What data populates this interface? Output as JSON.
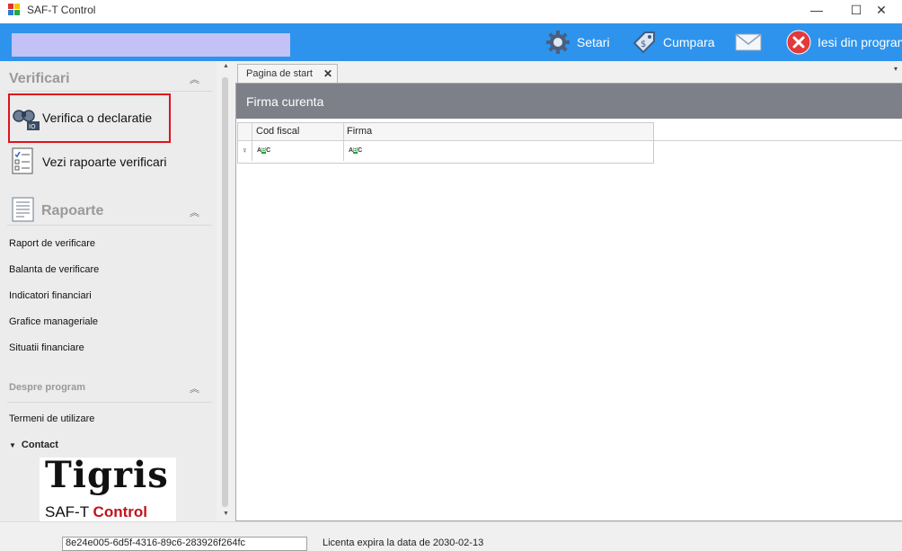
{
  "window": {
    "title": "SAF-T Control",
    "minimize": "—",
    "maximize": "☐",
    "close": "✕"
  },
  "toolbar": {
    "search_value": "",
    "setari_label": "Setari",
    "cumpara_label": "Cumpara",
    "exit_label": "Iesi din program",
    "bg_color": "#2e93ec"
  },
  "sidebar": {
    "verificari": {
      "title": "Verificari",
      "items": [
        {
          "label": "Verifica o declaratie",
          "icon": "binoculars-icon",
          "highlighted": true
        },
        {
          "label": "Vezi rapoarte verificari",
          "icon": "checklist-icon"
        }
      ]
    },
    "rapoarte": {
      "title": "Rapoarte",
      "items": [
        "Raport de verificare",
        "Balanta de verificare",
        "Indicatori financiari",
        "Grafice manageriale",
        "Situatii financiare"
      ]
    },
    "despre": {
      "title": "Despre program",
      "items": [
        "Termeni de utilizare"
      ],
      "contact_label": "Contact"
    },
    "logo": {
      "brand": "Tigris",
      "product_prefix": "SAF-T",
      "product_suffix": "Control"
    }
  },
  "main": {
    "tab_label": "Pagina de start",
    "panel_title": "Firma curenta",
    "grid": {
      "columns": [
        "Cod fiscal",
        "Firma"
      ]
    }
  },
  "status": {
    "license_key": "8e24e005-6d5f-4316-89c6-283926f264fc",
    "license_text": "Licenta expira la data de 2030-02-13"
  }
}
